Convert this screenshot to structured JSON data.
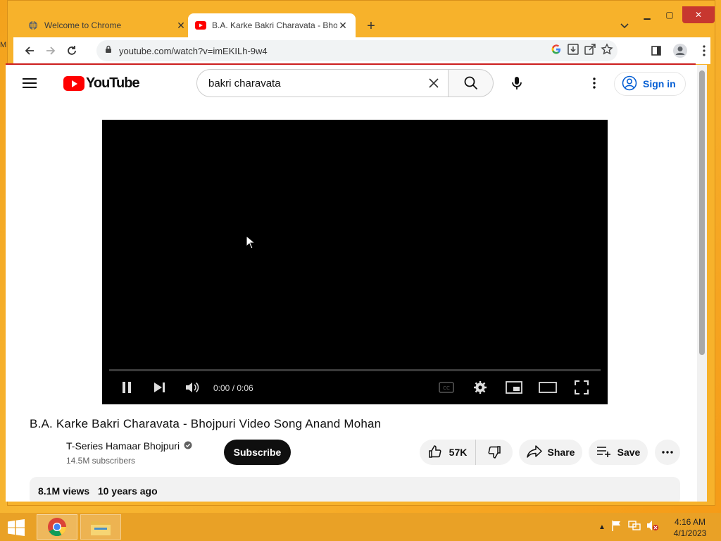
{
  "desktop": {
    "edge_label": "M"
  },
  "browser": {
    "tabs": [
      {
        "title": "Welcome to Chrome",
        "favicon": "globe-icon",
        "active": false
      },
      {
        "title": "B.A. Karke Bakri Charavata - Bhojpuri",
        "favicon": "youtube-icon",
        "active": true
      }
    ],
    "url": "youtube.com/watch?v=imEKILh-9w4"
  },
  "youtube": {
    "search_query": "bakri charavata",
    "sign_in_label": "Sign in",
    "player": {
      "time": "0:00 / 0:06",
      "progress": 0.0
    },
    "video": {
      "title": "B.A. Karke Bakri Charavata - Bhojpuri Video Song Anand Mohan",
      "channel": "T-Series Hamaar Bhojpuri",
      "subscribers": "14.5M subscribers",
      "subscribe_label": "Subscribe",
      "likes": "57K",
      "share_label": "Share",
      "save_label": "Save",
      "views": "8.1M views",
      "age": "10 years ago"
    }
  },
  "taskbar": {
    "time": "4:16 AM",
    "date": "4/1/2023"
  },
  "colors": {
    "accent_red": "#ff0000",
    "link_blue": "#065fd4",
    "taskbar": "#e9a126"
  }
}
